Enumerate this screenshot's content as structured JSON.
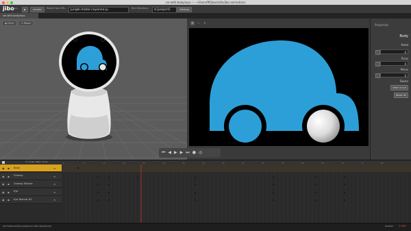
{
  "window": {
    "title": "car-with-body.keys — ~/Users/fff/jibo/skills/jibo-animations"
  },
  "toolbar": {
    "logo": "jibo",
    "logo_sub": "Beta",
    "play_icon": "play-icon",
    "remote_label": "remote",
    "robot_host_label": "Robot Host URL:",
    "robot_host_value": "jungle-motor-cayenne-ju",
    "run_directory_label": "Run Directory:",
    "run_directory_value": "${project}",
    "settings_label": "Settings"
  },
  "tabs": [
    {
      "label": "car-with-body.keys"
    }
  ],
  "viewport": {
    "front_label": "Front",
    "reset_label": "Reset"
  },
  "preview": {
    "toolbar_icons": [
      "plus-icon",
      "minus-icon",
      "refresh-icon"
    ],
    "playback_icons": [
      "skip-back-icon",
      "step-back-icon",
      "play-icon",
      "step-forward-icon",
      "skip-forward-icon",
      "record-icon",
      "loop-icon"
    ],
    "colors": {
      "car": "#2d9fd8",
      "wheel": "#2d9fd8",
      "eye_ball": "#e8e8e8",
      "background": "#000000"
    }
  },
  "properties": {
    "header": "Properties",
    "section": "Body",
    "fields": [
      {
        "label": "Head",
        "value": "0"
      },
      {
        "label": "Torso",
        "value": "0"
      },
      {
        "label": "Pelvis",
        "value": "0"
      }
    ],
    "tween_label": "Tween",
    "tween_value": "ease in-out",
    "reset_all_label": "Reset All"
  },
  "timeline": {
    "fps_info": "15 of 96, 30fps, 10.4s",
    "ticks": [
      "0",
      "5",
      "10",
      "15",
      "20",
      "25",
      "30",
      "35",
      "40",
      "45",
      "50",
      "55",
      "60",
      "65",
      "70",
      "75",
      "80"
    ],
    "layers": [
      {
        "name": "Body",
        "selected": true
      },
      {
        "name": "Overlay",
        "selected": false
      },
      {
        "name": "Overlay Texture",
        "selected": false
      },
      {
        "name": "Eye",
        "selected": false
      },
      {
        "name": "Eye Texture #2",
        "selected": false
      }
    ]
  },
  "statusbar": {
    "path": "animations/jibo-posts/car-with-body.keys",
    "branch": "master",
    "status": "2 ERR"
  }
}
